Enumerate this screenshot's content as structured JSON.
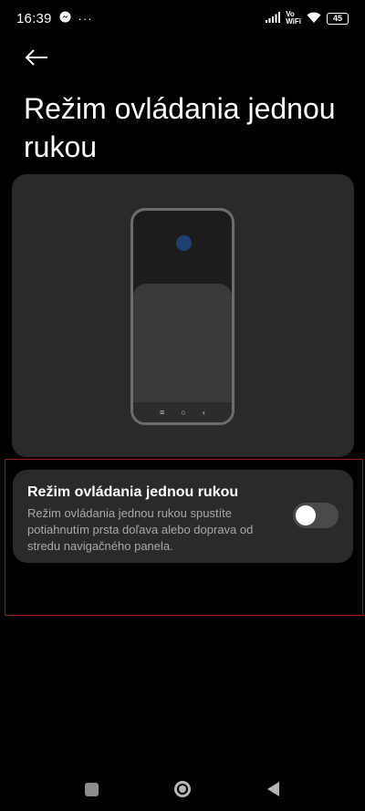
{
  "status_bar": {
    "time": "16:39",
    "more_dots": "···",
    "network_label_top": "Vo",
    "network_label_bottom": "WiFi",
    "battery": "45"
  },
  "header": {
    "title": "Režim ovládania jednou rukou"
  },
  "illustration": {
    "nav_recents": "≡",
    "nav_home": "○",
    "nav_back": "‹"
  },
  "setting": {
    "title": "Režim ovládania jednou rukou",
    "description": "Režim ovládania jednou rukou spustíte potiahnutím prsta doľava alebo doprava od stredu navigačného panela.",
    "enabled": false
  },
  "colors": {
    "background": "#000000",
    "card": "#2a2a2a",
    "highlight_border": "#9b1c1c",
    "accent_dot": "#1e3f70"
  },
  "icons": [
    "messenger-icon",
    "signal-icon",
    "wifi-icon",
    "battery-icon",
    "back-arrow-icon",
    "recents-icon",
    "home-icon",
    "back-icon"
  ]
}
